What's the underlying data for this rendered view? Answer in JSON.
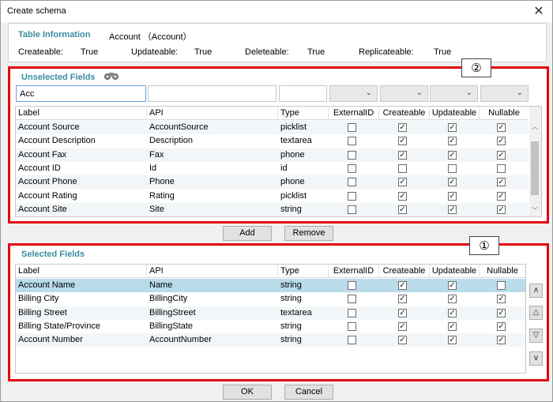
{
  "window": {
    "title": "Create schema"
  },
  "table_info": {
    "heading": "Table Information",
    "object": "Account （Account）",
    "fields": [
      {
        "label": "Createable:",
        "value": "True"
      },
      {
        "label": "Updateable:",
        "value": "True"
      },
      {
        "label": "Deleteable:",
        "value": "True"
      },
      {
        "label": "Replicateable:",
        "value": "True"
      }
    ]
  },
  "unselected": {
    "heading": "Unselected Fields",
    "badge": "②",
    "filter_label_value": "Acc",
    "filter_api_value": "",
    "filter_type_value": "",
    "columns": [
      "Label",
      "API",
      "Type",
      "ExternalID",
      "Createable",
      "Updateable",
      "Nullable"
    ],
    "rows": [
      {
        "label": "Account Source",
        "api": "AccountSource",
        "type": "picklist",
        "checks": [
          false,
          true,
          true,
          true
        ]
      },
      {
        "label": "Account Description",
        "api": "Description",
        "type": "textarea",
        "checks": [
          false,
          true,
          true,
          true
        ]
      },
      {
        "label": "Account Fax",
        "api": "Fax",
        "type": "phone",
        "checks": [
          false,
          true,
          true,
          true
        ]
      },
      {
        "label": "Account ID",
        "api": "Id",
        "type": "id",
        "checks": [
          false,
          false,
          false,
          false
        ]
      },
      {
        "label": "Account Phone",
        "api": "Phone",
        "type": "phone",
        "checks": [
          false,
          true,
          true,
          true
        ]
      },
      {
        "label": "Account Rating",
        "api": "Rating",
        "type": "picklist",
        "checks": [
          false,
          true,
          true,
          true
        ]
      },
      {
        "label": "Account Site",
        "api": "Site",
        "type": "string",
        "checks": [
          false,
          true,
          true,
          true
        ]
      }
    ]
  },
  "buttons": {
    "add": "Add",
    "remove": "Remove",
    "ok": "OK",
    "cancel": "Cancel"
  },
  "selected": {
    "heading": "Selected Fields",
    "badge": "①",
    "columns": [
      "Label",
      "API",
      "Type",
      "ExternalID",
      "Createable",
      "Updateable",
      "Nullable"
    ],
    "rows": [
      {
        "label": "Account Name",
        "api": "Name",
        "type": "string",
        "checks": [
          false,
          true,
          true,
          false
        ]
      },
      {
        "label": "Billing City",
        "api": "BillingCity",
        "type": "string",
        "checks": [
          false,
          true,
          true,
          true
        ]
      },
      {
        "label": "Billing Street",
        "api": "BillingStreet",
        "type": "textarea",
        "checks": [
          false,
          true,
          true,
          true
        ]
      },
      {
        "label": "Billing State/Province",
        "api": "BillingState",
        "type": "string",
        "checks": [
          false,
          true,
          true,
          true
        ]
      },
      {
        "label": "Account Number",
        "api": "AccountNumber",
        "type": "string",
        "checks": [
          false,
          true,
          true,
          true
        ]
      }
    ],
    "order_buttons": [
      "∧",
      "△",
      "▽",
      "∨"
    ]
  }
}
